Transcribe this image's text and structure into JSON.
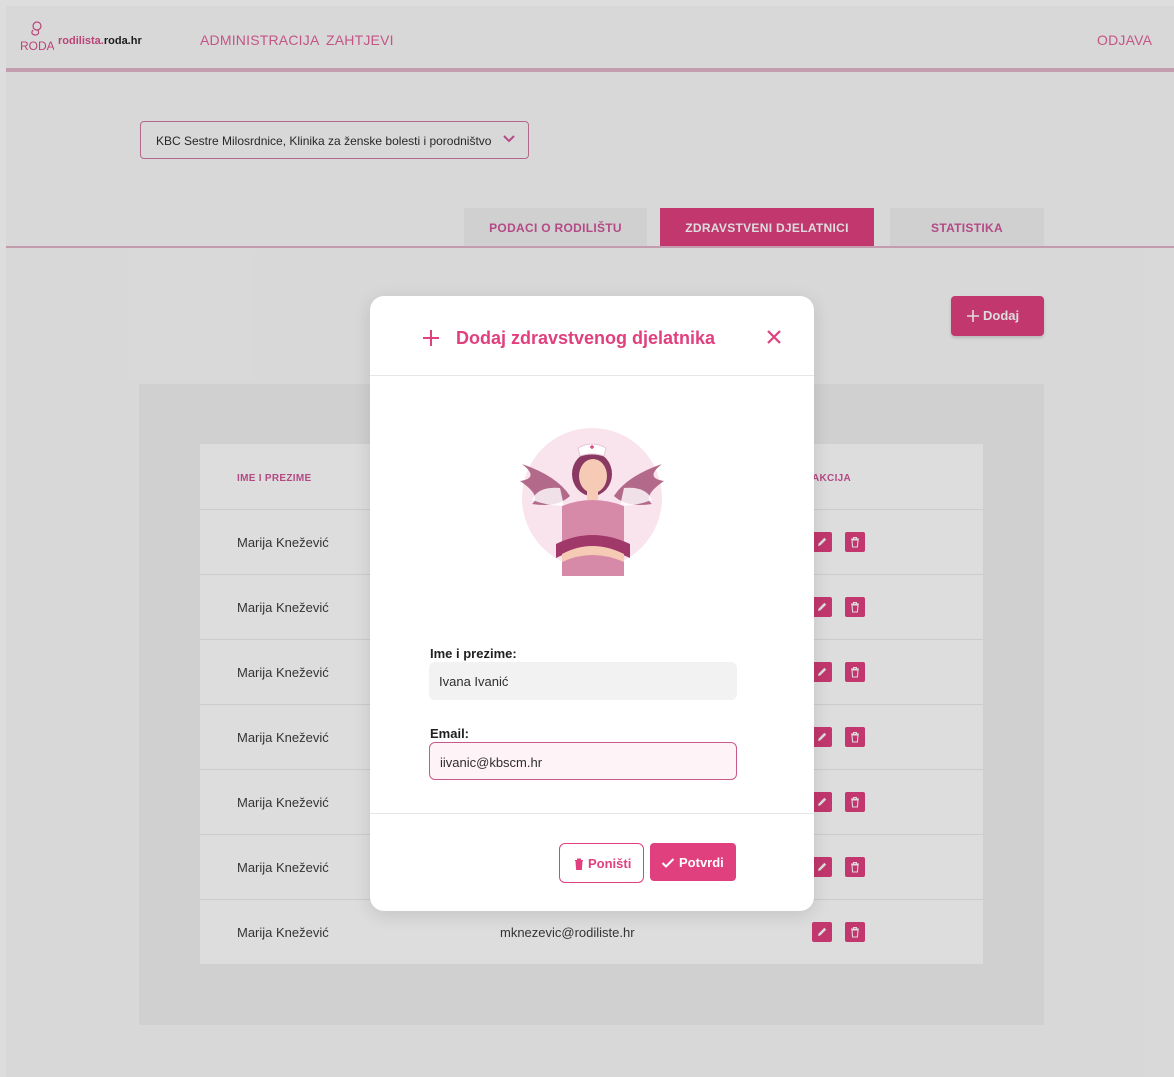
{
  "navbar": {
    "logo_text_pink": "rodilista.",
    "logo_text_dark": "roda.hr",
    "logo_mark": "RODA",
    "links": [
      "ADMINISTRACIJA",
      "ZAHTJEVI"
    ],
    "logout": "ODJAVA"
  },
  "hospital_select": {
    "value": "KBC Sestre Milosrdnice, Klinika za ženske bolesti i porodništvo",
    "icon": "chevron-down-icon"
  },
  "tabs": [
    {
      "label": "PODACI O RODILIŠTU",
      "active": false
    },
    {
      "label": "ZDRAVSTVENI DJELATNICI",
      "active": true
    },
    {
      "label": "STATISTIKA",
      "active": false
    }
  ],
  "add_button": {
    "label": "Dodaj",
    "icon": "plus-icon"
  },
  "table": {
    "headers": {
      "name": "IME I PREZIME",
      "action": "AKCIJA"
    },
    "rows": [
      {
        "name": "Marija Knežević",
        "email": ""
      },
      {
        "name": "Marija Knežević",
        "email": ""
      },
      {
        "name": "Marija Knežević",
        "email": ""
      },
      {
        "name": "Marija Knežević",
        "email": ""
      },
      {
        "name": "Marija Knežević",
        "email": ""
      },
      {
        "name": "Marija Knežević",
        "email": ""
      },
      {
        "name": "Marija Knežević",
        "email": "mknezevic@rodiliste.hr"
      }
    ]
  },
  "modal": {
    "title": "Dodaj zdravstvenog djelatnika",
    "name_label": "Ime i prezime:",
    "name_value": "Ivana Ivanić",
    "email_label": "Email:",
    "email_value": "iivanic@kbscm.hr",
    "cancel_label": "Poništi",
    "confirm_label": "Potvrdi"
  },
  "colors": {
    "accent": "#e0407e",
    "accent_light": "#e2b6c8",
    "overlay": "rgba(0,0,0,0.135)"
  }
}
